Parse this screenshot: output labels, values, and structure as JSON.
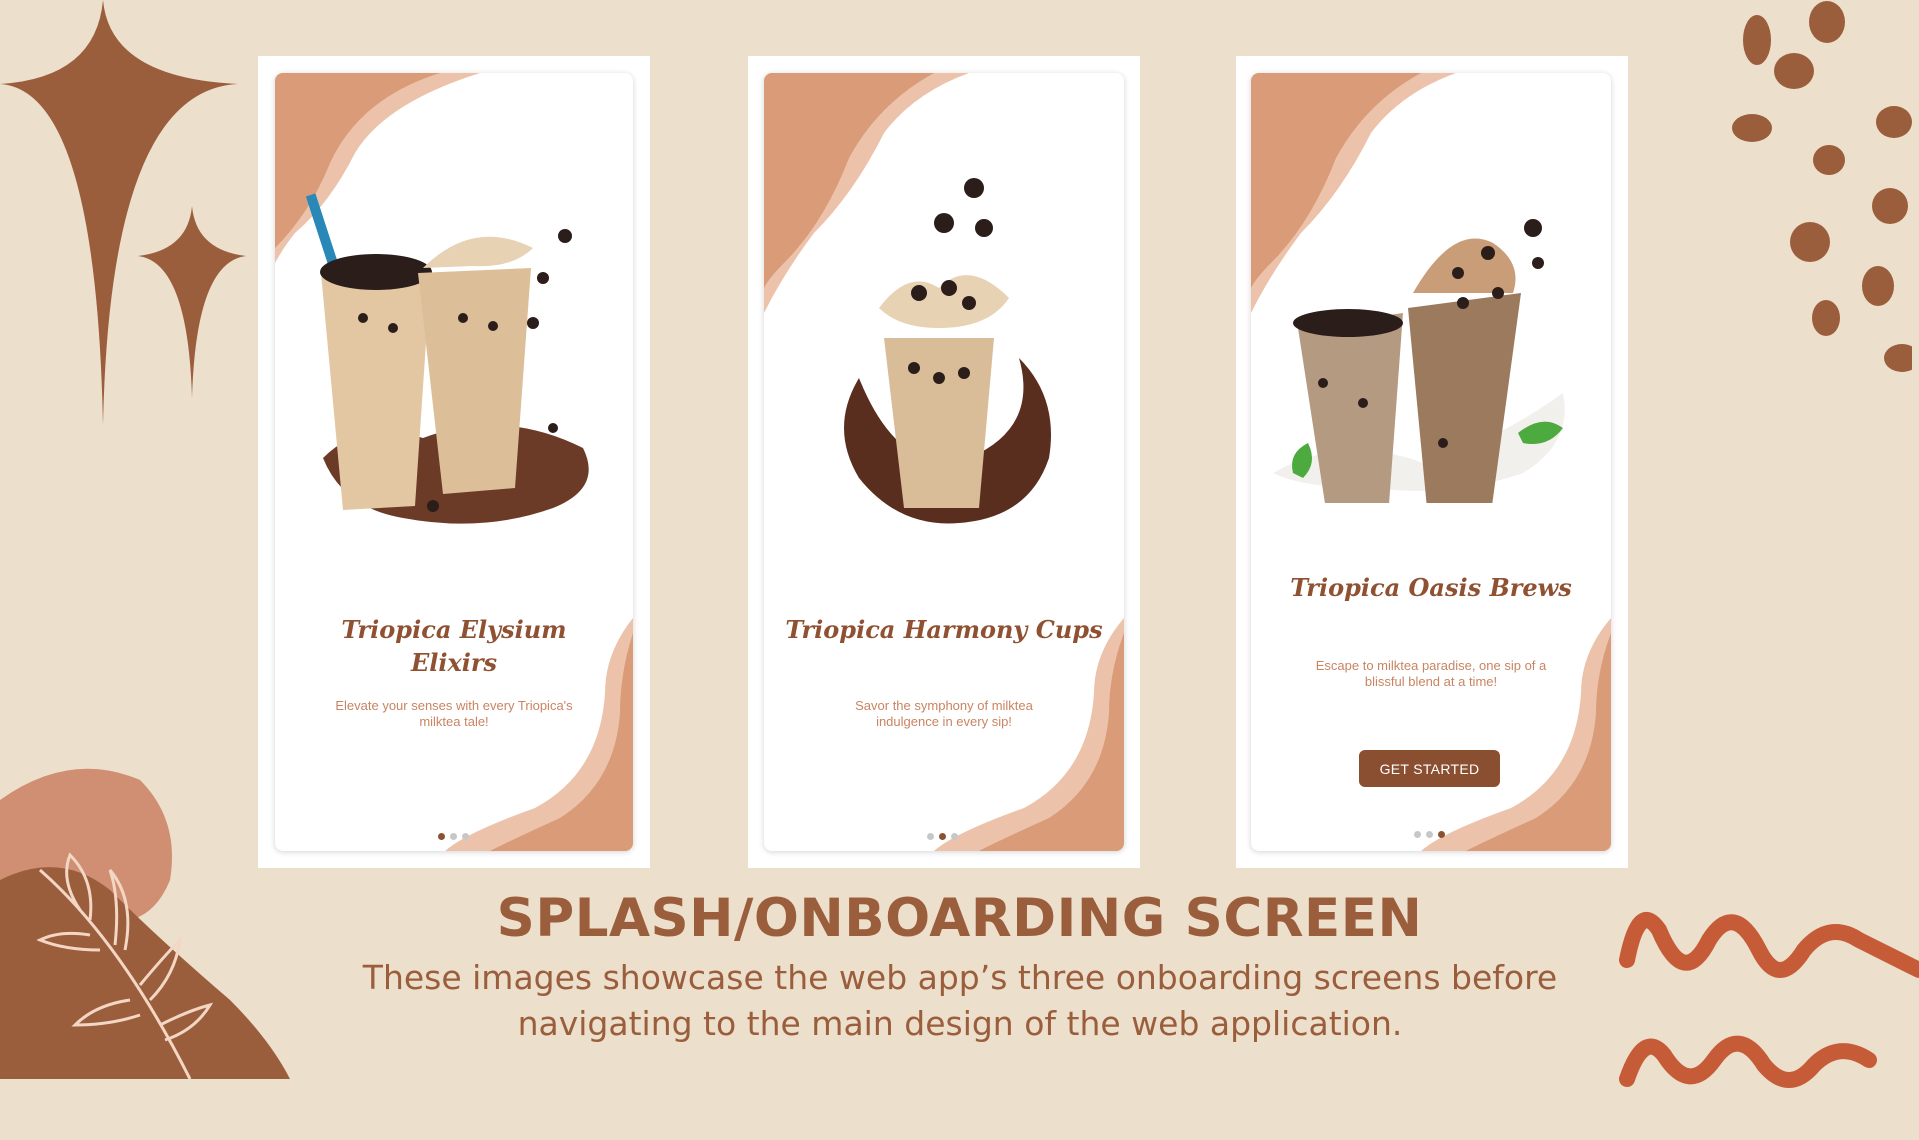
{
  "colors": {
    "background": "#ecdfcc",
    "accent": "#9b5e3c",
    "card_wave": "#d99b78",
    "card_wave_light": "#ecc3aa",
    "button": "#8a4f30",
    "subtitle": "#c98462"
  },
  "icons": [
    "sparkle-star-icon",
    "small-sparkle-icon",
    "dot-pattern-icon",
    "leaf-branch-icon",
    "squiggle-icon",
    "milk-tea-illustration"
  ],
  "screens": [
    {
      "title": "Triopica Elysium Elixirs",
      "subtitle": "Elevate your senses with every Triopica's milktea tale!",
      "active_dot": 1,
      "button": ""
    },
    {
      "title": "Triopica Harmony Cups",
      "subtitle": "Savor the symphony of milktea indulgence in every sip!",
      "active_dot": 2,
      "button": ""
    },
    {
      "title": "Triopica Oasis Brews",
      "subtitle": "Escape to milktea paradise, one sip of a blissful blend at a time!",
      "active_dot": 3,
      "button": "GET STARTED"
    }
  ],
  "heading": "SPLASH/ONBOARDING SCREEN",
  "description": "These images showcase the web app’s three onboarding screens before navigating to the main design of the web application."
}
